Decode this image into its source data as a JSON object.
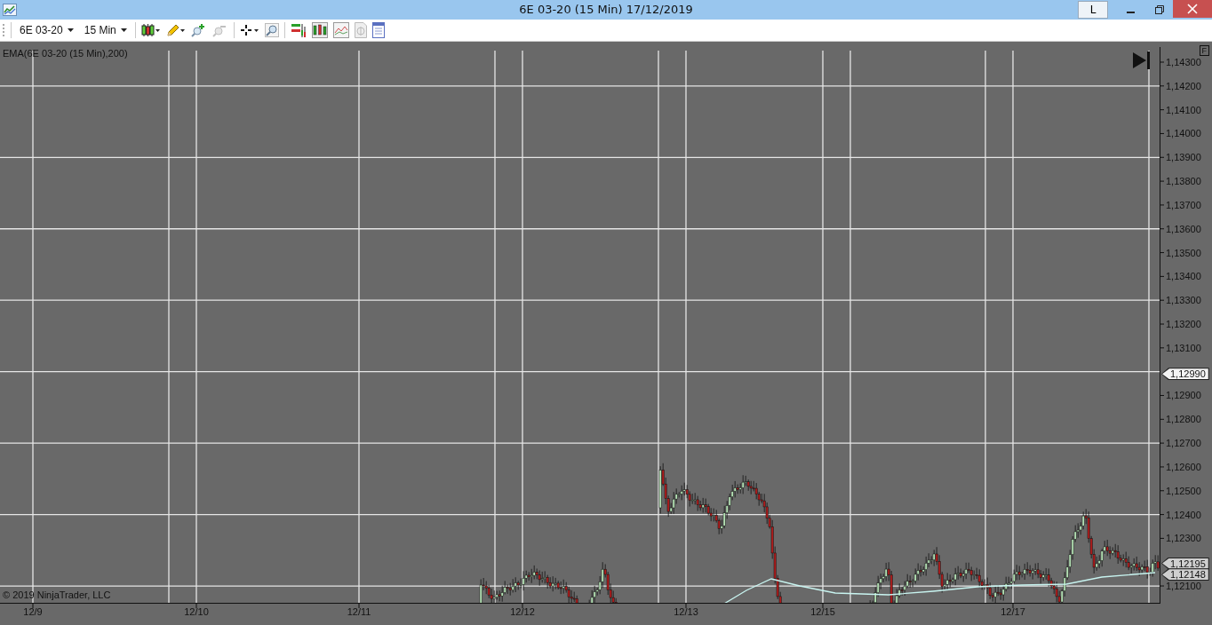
{
  "window": {
    "title": "6E 03-20 (15 Min)  17/12/2019",
    "buttons": [
      "L"
    ]
  },
  "toolbar": {
    "instrument": "6E 03-20",
    "interval": "15 Min"
  },
  "indicator_label": "EMA(6E 03-20 (15 Min),200)",
  "copyright": "© 2019 NinjaTrader, LLC",
  "price_axis": {
    "corner_label": "F",
    "ticks": [
      "1,14300",
      "1,14200",
      "1,14100",
      "1,14000",
      "1,13900",
      "1,13800",
      "1,13700",
      "1,13600",
      "1,13500",
      "1,13400",
      "1,13300",
      "1,13200",
      "1,13100",
      "1,12900",
      "1,12800",
      "1,12700",
      "1,12600",
      "1,12500",
      "1,12400",
      "1,12300",
      "1,12100"
    ],
    "markers": [
      {
        "value": "1,12990",
        "kind": "highlight"
      },
      {
        "value": "1,12195",
        "kind": "price"
      },
      {
        "value": "1,12148",
        "kind": "price"
      }
    ]
  },
  "time_axis": {
    "ticks": [
      "12/9",
      "12/10",
      "12/11",
      "12/12",
      "12/13",
      "12/15",
      "12/17"
    ]
  }
}
